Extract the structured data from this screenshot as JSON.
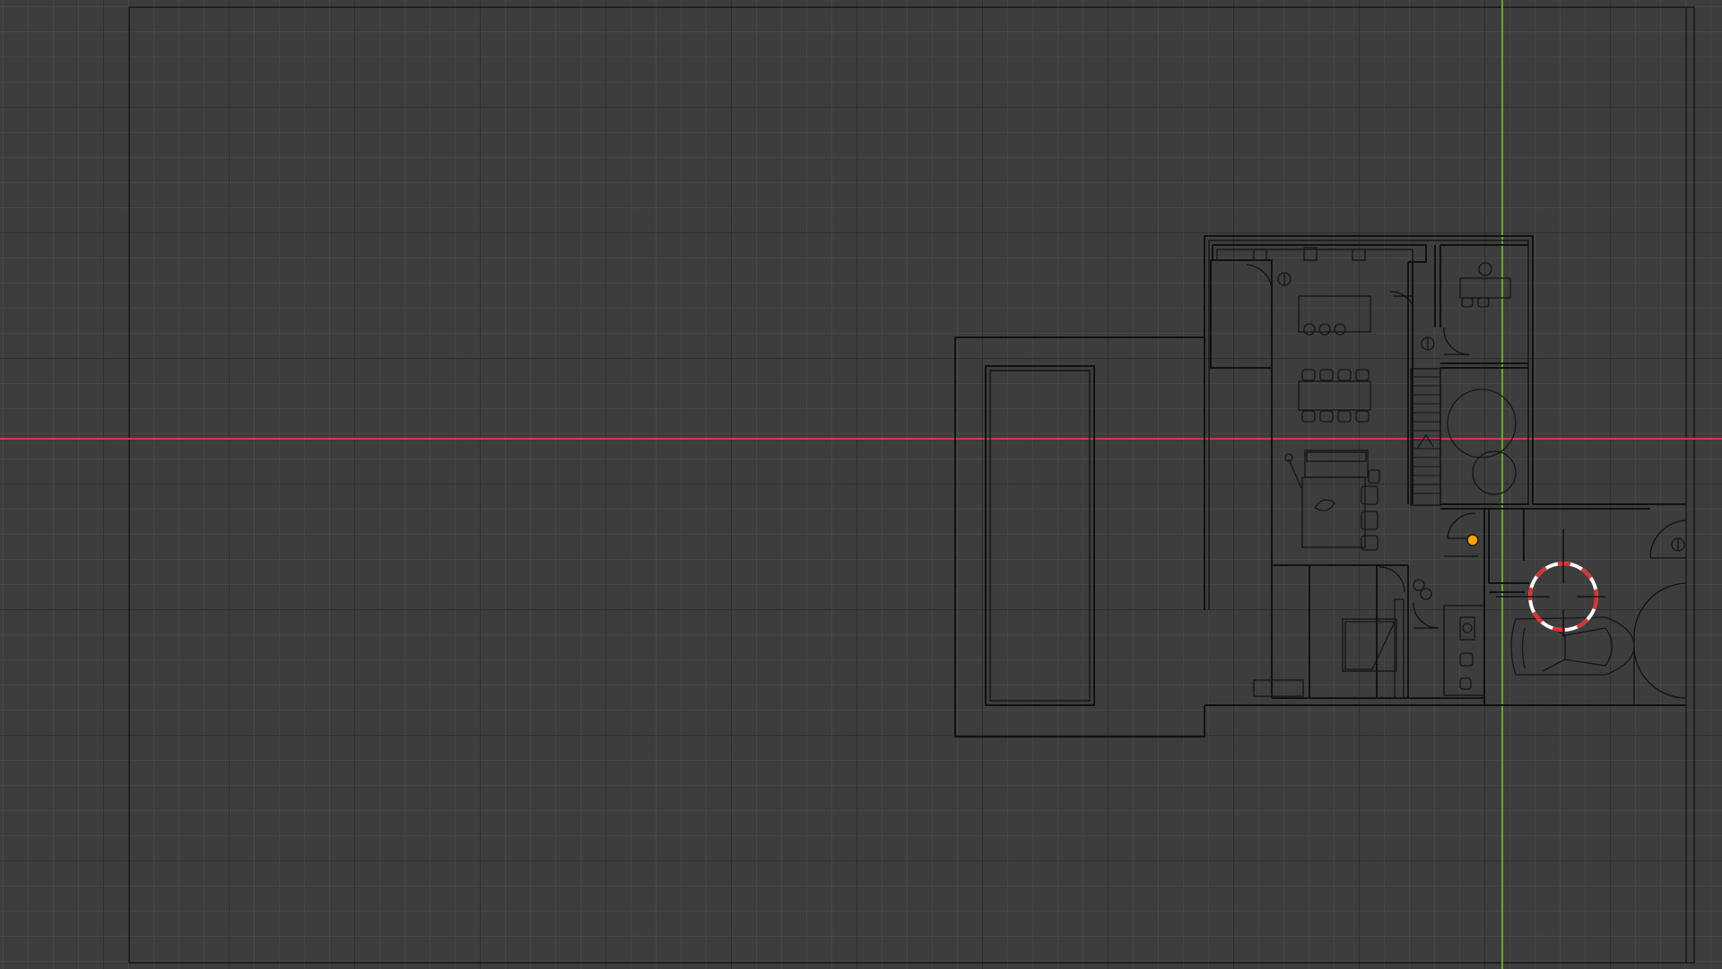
{
  "viewport": {
    "background": "#3d3d3d",
    "grid_minor_color": "#474747",
    "grid_major_color": "#2f2f2f"
  },
  "axes": {
    "x_axis_color": "#c2404f",
    "y_axis_color": "#6fa52a"
  },
  "selection": {
    "origin_color": "#ffa500"
  },
  "cursor": {
    "name": "3d-cursor-icon",
    "colors": [
      "#e03030",
      "#ffffff"
    ]
  },
  "drawing": {
    "line_color": "#111111",
    "object_name": "floor-plan"
  }
}
